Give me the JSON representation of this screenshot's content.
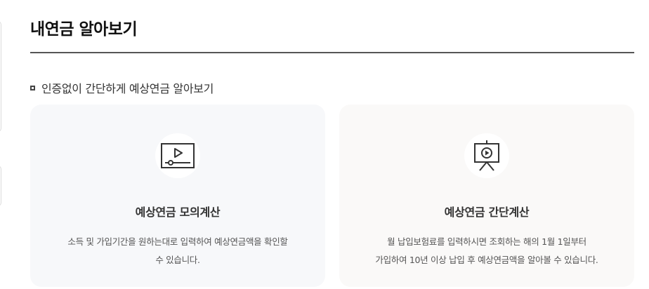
{
  "page": {
    "title": "내연금 알아보기"
  },
  "section": {
    "heading": "인증없이 간단하게 예상연금 알아보기"
  },
  "cards": [
    {
      "icon": "video-player-icon",
      "title": "예상연금 모의계산",
      "desc_lines": [
        "소득 및 가입기간을 원하는대로 입력하여 예상연금액을 확인할",
        "수 있습니다."
      ]
    },
    {
      "icon": "presentation-board-icon",
      "title": "예상연금 간단계산",
      "desc_lines": [
        "월 납입보험료를 입력하시면 조회하는 해의 1월 1일부터",
        "가입하여 10년 이상 납입 후 예상연금액을 알아볼 수 있습니다."
      ]
    }
  ]
}
